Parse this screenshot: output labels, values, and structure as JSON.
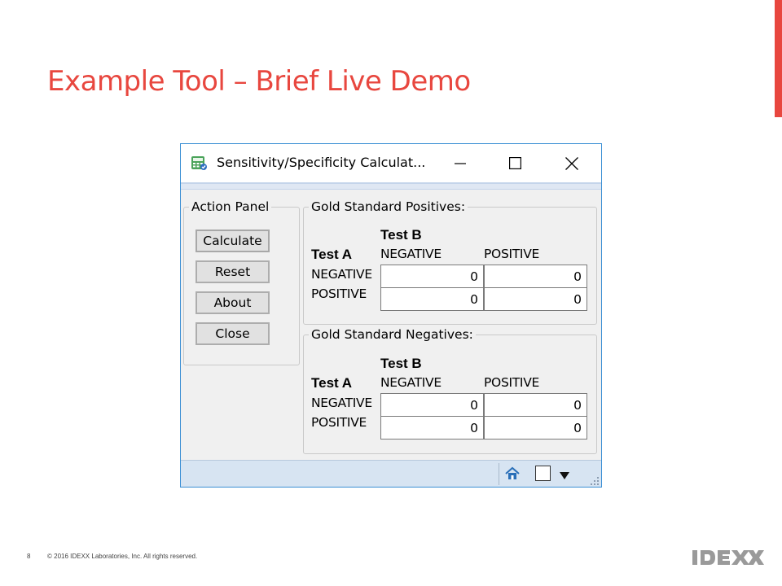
{
  "colors": {
    "accent": "#e8473f",
    "window_border": "#3b8fd4",
    "statusbar": "#d7e4f2",
    "logo_gray": "#9a9a9a"
  },
  "slide": {
    "title": "Example Tool – Brief Live Demo",
    "page_number": "8",
    "copyright": "© 2016 IDEXX Laboratories, Inc. All rights reserved.",
    "logo_text": "IDEXX"
  },
  "window": {
    "title": "Sensitivity/Specificity Calculat...",
    "app_icon": "calculator-app-icon",
    "controls": {
      "minimize": "minimize-icon",
      "maximize": "maximize-icon",
      "close": "close-icon"
    }
  },
  "action_panel": {
    "legend": "Action Panel",
    "buttons": {
      "calculate": "Calculate",
      "reset": "Reset",
      "about": "About",
      "close": "Close"
    }
  },
  "gold_positives": {
    "legend": "Gold Standard Positives:",
    "test_b": "Test B",
    "test_a": "Test A",
    "col_negative": "NEGATIVE",
    "col_positive": "POSITIVE",
    "row_negative": "NEGATIVE",
    "row_positive": "POSITIVE",
    "values": {
      "neg_neg": "0",
      "neg_pos": "0",
      "pos_neg": "0",
      "pos_pos": "0"
    }
  },
  "gold_negatives": {
    "legend": "Gold Standard Negatives:",
    "test_b": "Test B",
    "test_a": "Test A",
    "col_negative": "NEGATIVE",
    "col_positive": "POSITIVE",
    "row_negative": "NEGATIVE",
    "row_positive": "POSITIVE",
    "values": {
      "neg_neg": "0",
      "neg_pos": "0",
      "pos_neg": "0",
      "pos_pos": "0"
    }
  },
  "statusbar": {
    "icons": [
      "home-icon",
      "checkbox",
      "dropdown-arrow-icon",
      "resize-grip-icon"
    ]
  }
}
